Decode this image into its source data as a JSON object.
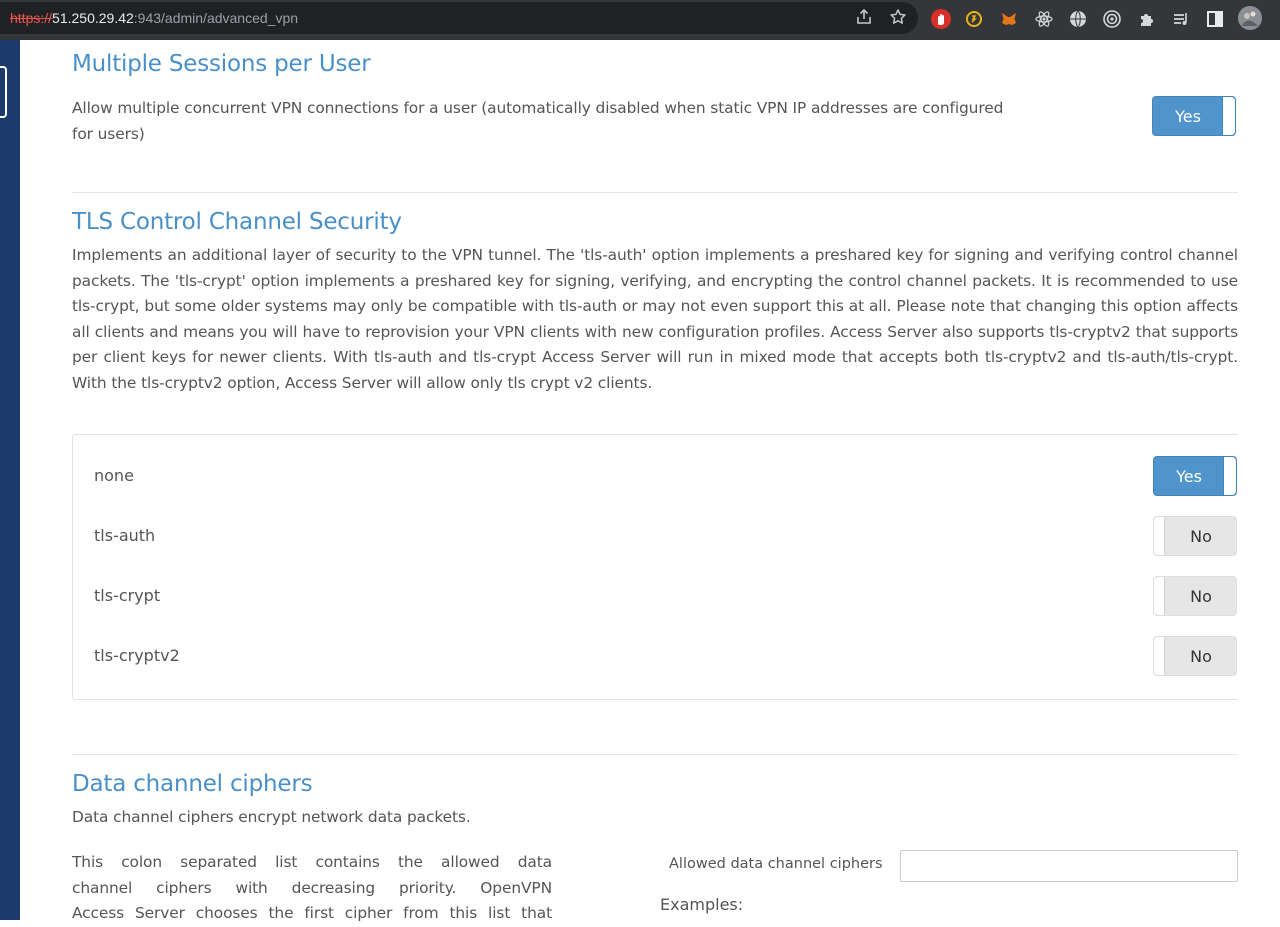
{
  "browser": {
    "url_scheme": "https://",
    "url_host": "51.250.29.42",
    "url_rest": ":943/admin/advanced_vpn",
    "icons": [
      "share-icon",
      "bookmark-star-icon"
    ],
    "extensions": [
      {
        "name": "adblock-extension-icon",
        "color": "#d9302a",
        "glyph": "✋"
      },
      {
        "name": "coin-extension-icon",
        "color": "#e7b416",
        "glyph": "◎"
      },
      {
        "name": "metamask-extension-icon",
        "color": "#e2761b",
        "glyph": "🦊"
      },
      {
        "name": "react-devtools-icon",
        "color": "#35363a",
        "glyph": "⚛"
      },
      {
        "name": "globe-extension-icon",
        "color": "#35363a",
        "glyph": "◍"
      },
      {
        "name": "target-extension-icon",
        "color": "#35363a",
        "glyph": "◉"
      },
      {
        "name": "puzzle-extensions-icon",
        "color": "#35363a",
        "glyph": "✚"
      },
      {
        "name": "media-queue-icon",
        "color": "#35363a",
        "glyph": "≡"
      },
      {
        "name": "side-panel-icon",
        "color": "#35363a",
        "glyph": "▣"
      },
      {
        "name": "profile-avatar",
        "color": "#6b6f75",
        "glyph": ""
      }
    ]
  },
  "multi_sessions": {
    "title": "Multiple Sessions per User",
    "description_line1": "Allow multiple concurrent VPN connections for a user (automatically disabled when static VPN IP addresses are configured",
    "description_line2": "for users)",
    "toggle": "Yes"
  },
  "tls": {
    "title": "TLS Control Channel Security",
    "description": "Implements an additional layer of security to the VPN tunnel. The 'tls-auth' option implements a preshared key for signing and verifying control channel packets. The 'tls-crypt' option implements a preshared key for signing, verifying, and encrypting the control channel packets. It is recommended to use tls-crypt, but some older systems may only be compatible with tls-auth or may not even support this at all. Please note that changing this option affects all clients and means you will have to reprovision your VPN clients with new configuration profiles. Access Server also supports tls-cryptv2 that supports per client keys for newer clients. With tls-auth and tls-crypt Access Server will run in mixed mode that accepts both tls-cryptv2 and tls-auth/tls-crypt. With the tls-cryptv2 option, Access Server will allow only tls crypt v2 clients.",
    "options": [
      {
        "label": "none",
        "toggle": "Yes",
        "on": true
      },
      {
        "label": "tls-auth",
        "toggle": "No",
        "on": false
      },
      {
        "label": "tls-crypt",
        "toggle": "No",
        "on": false
      },
      {
        "label": "tls-cryptv2",
        "toggle": "No",
        "on": false
      }
    ]
  },
  "ciphers": {
    "title": "Data channel ciphers",
    "description": "Data channel ciphers encrypt network data packets.",
    "help_line1": "This colon separated list contains the allowed data",
    "help_line2": "channel ciphers with decreasing priority. OpenVPN",
    "help_line3": "Access Server chooses the first cipher from this list that",
    "field_label": "Allowed data channel ciphers",
    "field_value": "",
    "examples_label": "Examples:"
  }
}
